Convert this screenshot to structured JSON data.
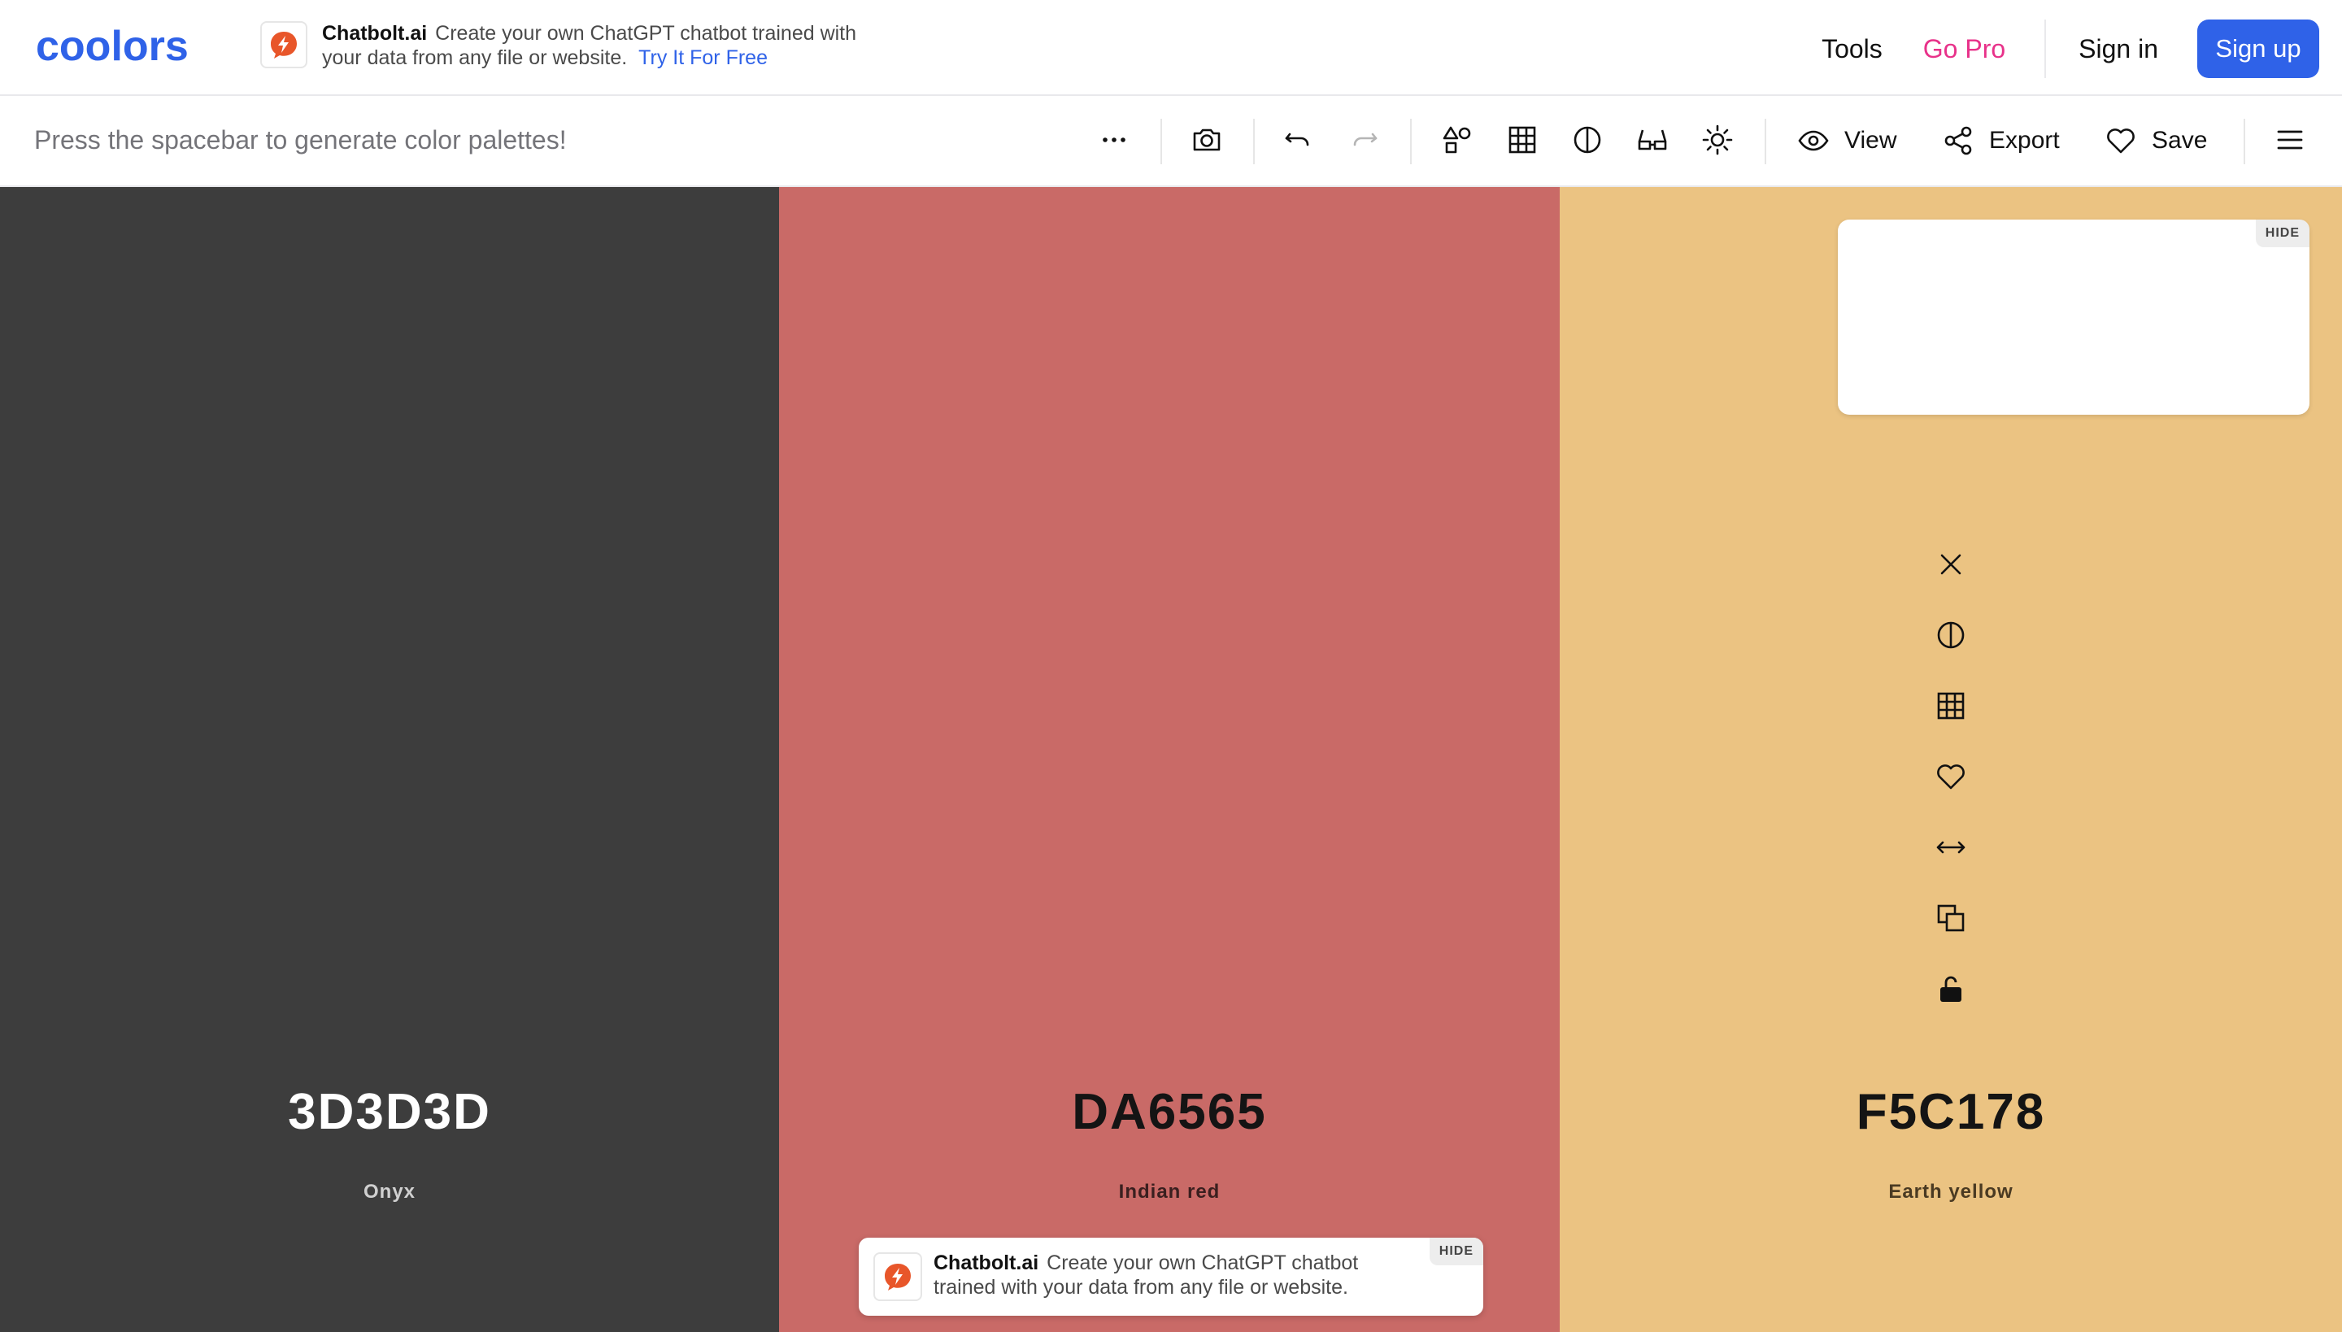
{
  "header": {
    "logo_text": "coolors",
    "ad": {
      "brand": "Chatbolt.ai",
      "text": "Create your own ChatGPT chatbot trained with your data from any file or website.",
      "cta": "Try It For Free"
    },
    "nav": {
      "tools": "Tools",
      "go_pro": "Go Pro",
      "sign_in": "Sign in",
      "sign_up": "Sign up"
    }
  },
  "toolbar": {
    "hint": "Press the spacebar to generate color palettes!",
    "icons": [
      "more-icon",
      "camera-icon",
      "undo-icon",
      "redo-icon",
      "shapes-icon",
      "grid-icon",
      "contrast-icon",
      "glasses-icon",
      "brightness-icon"
    ],
    "view_label": "View",
    "export_label": "Export",
    "save_label": "Save"
  },
  "palette": {
    "colors": [
      {
        "hex": "3D3D3D",
        "name": "Onyx",
        "bg": "#3d3d3d",
        "fg": "#ffffff",
        "sub": "#d0d0d0"
      },
      {
        "hex": "DA6565",
        "name": "Indian red",
        "bg": "#c96a67",
        "fg": "#141414",
        "sub": "#3a1f1f"
      },
      {
        "hex": "F5C178",
        "name": "Earth yellow",
        "bg": "#ebc382",
        "fg": "#141414",
        "sub": "#4a3a22"
      }
    ],
    "column_tools": [
      "close-icon",
      "contrast-icon",
      "grid-icon",
      "heart-icon",
      "drag-icon",
      "copy-icon",
      "lock-open-icon"
    ]
  },
  "ads": {
    "side_hide": "HIDE",
    "bottom": {
      "brand": "Chatbolt.ai",
      "text": "Create your own ChatGPT chatbot trained with your data from any file or website.",
      "hide": "HIDE"
    }
  },
  "colors": {
    "accent": "#2f62e8",
    "go_pro": "#e8328a",
    "chatbolt_orange": "#e8562a"
  }
}
